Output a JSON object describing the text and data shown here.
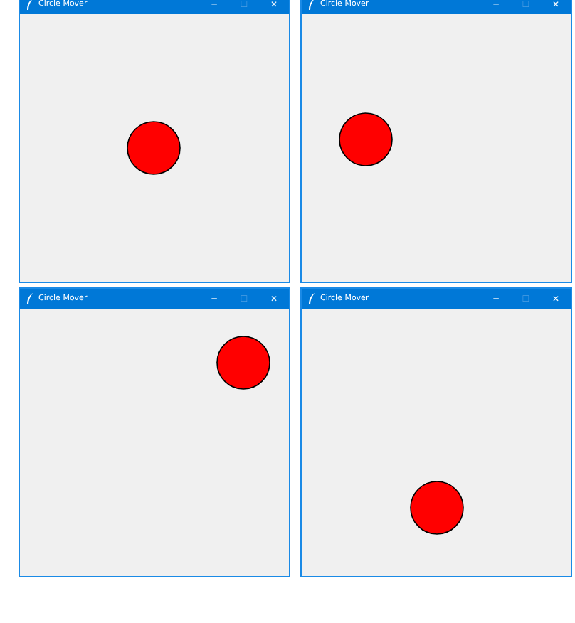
{
  "windows": [
    {
      "title": "Circle Mover",
      "minimize": "─",
      "maximize": "☐",
      "maximize_disabled": true,
      "close": "✕"
    },
    {
      "title": "Circle Mover",
      "minimize": "─",
      "maximize": "☐",
      "maximize_disabled": true,
      "close": "✕"
    },
    {
      "title": "Circle Mover",
      "minimize": "─",
      "maximize": "☐",
      "maximize_disabled": true,
      "close": "✕"
    },
    {
      "title": "Circle Mover",
      "minimize": "─",
      "maximize": "☐",
      "maximize_disabled": true,
      "close": "✕"
    }
  ]
}
